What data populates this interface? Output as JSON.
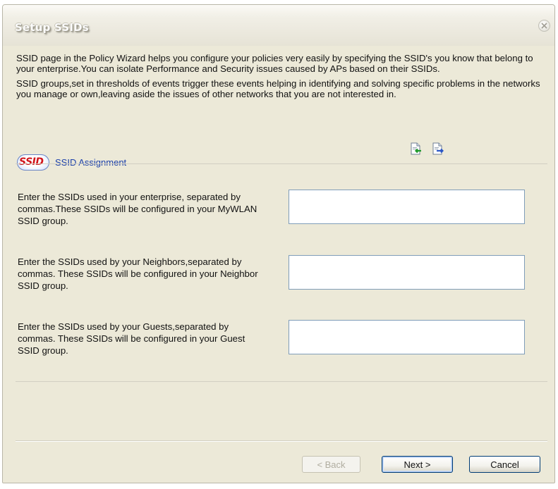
{
  "dialog": {
    "title": "Setup SSIDs"
  },
  "intro": {
    "paragraph1": "SSID page in the Policy Wizard helps you configure your policies very easily by specifying the SSID's you know that  belong to your enterprise.You can isolate Performance and Security issues caused by APs based on their SSIDs.",
    "paragraph2": "SSID groups,set in thresholds of events trigger these events helping in identifying and solving specific problems in the networks you manage or own,leaving aside the issues of other networks that you are not interested in."
  },
  "section": {
    "logo_text": "SSID",
    "label": "SSID Assignment"
  },
  "toolbar": {
    "icons": [
      "import-icon",
      "export-icon"
    ]
  },
  "rows": [
    {
      "label": "Enter the SSIDs used in your enterprise, separated by commas.These SSIDs will be configured in your MyWLAN SSID group.",
      "value": ""
    },
    {
      "label": "Enter the SSIDs used by your Neighbors,separated by commas. These SSIDs will be configured in your Neighbor SSID group.",
      "value": ""
    },
    {
      "label": "Enter the SSIDs used by your Guests,separated by commas. These SSIDs will be configured in your Guest SSID group.",
      "value": ""
    }
  ],
  "buttons": {
    "back": "< Back",
    "next": "Next >",
    "cancel": "Cancel"
  },
  "colors": {
    "window_bg": "#ece9d8",
    "section_label": "#1a3faa",
    "logo_red": "#d1141a",
    "input_border": "#7f9db9"
  }
}
